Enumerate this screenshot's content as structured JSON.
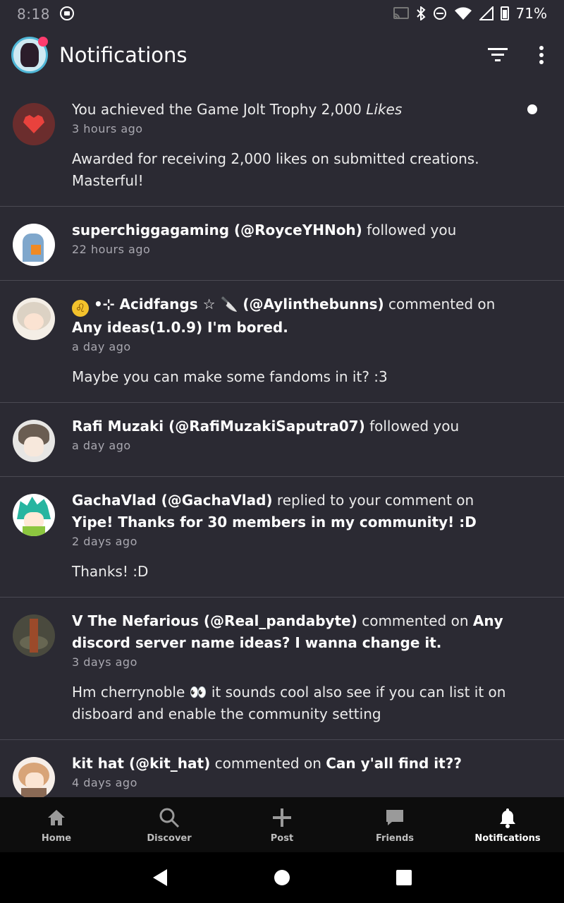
{
  "status_bar": {
    "time": "8:18",
    "battery": "71%"
  },
  "app_bar": {
    "title": "Notifications"
  },
  "notifications": [
    {
      "headline_text": "You achieved the Game Jolt Trophy 2,000 ",
      "headline_italic": "Likes",
      "time": "3 hours ago",
      "message": "Awarded for receiving 2,000 likes on submitted creations. Masterful!"
    },
    {
      "user": "superchiggagaming (@RoyceYHNoh)",
      "action": " followed you",
      "time": "22 hours ago"
    },
    {
      "user": " •⊹ Acidfangs ☆ 🔪 (@Aylinthebunns)",
      "action": " commented on ",
      "target": "Any ideas(1.0.9)  I'm bored.",
      "time": "a day ago",
      "message": "Maybe you can make some fandoms in it? :3"
    },
    {
      "user": "Rafi Muzaki (@RafiMuzakiSaputra07)",
      "action": " followed you",
      "time": "a day ago"
    },
    {
      "user": "GachaVlad (@GachaVlad)",
      "action": " replied to your comment on ",
      "target": "Yipe! Thanks for 30 members in my community! :D",
      "time": "2 days ago",
      "message": "Thanks! :D"
    },
    {
      "user": "V The Nefarious (@Real_pandabyte)",
      "action": " commented on ",
      "target": "Any discord server name ideas? I wanna change it.",
      "time": "3 days ago",
      "message": "Hm cherrynoble 👀 it sounds cool also see if you can list it on disboard and enable the community setting"
    },
    {
      "user": "kit hat (@kit_hat)",
      "action": " commented on ",
      "target": "Can y'all find it??",
      "time": "4 days ago"
    }
  ],
  "bottom_nav": [
    {
      "label": "Home",
      "icon": "home-icon"
    },
    {
      "label": "Discover",
      "icon": "search-icon"
    },
    {
      "label": "Post",
      "icon": "plus-icon"
    },
    {
      "label": "Friends",
      "icon": "chat-icon"
    },
    {
      "label": "Notifications",
      "icon": "bell-icon",
      "active": true
    }
  ],
  "zodiac_glyph": "♌"
}
